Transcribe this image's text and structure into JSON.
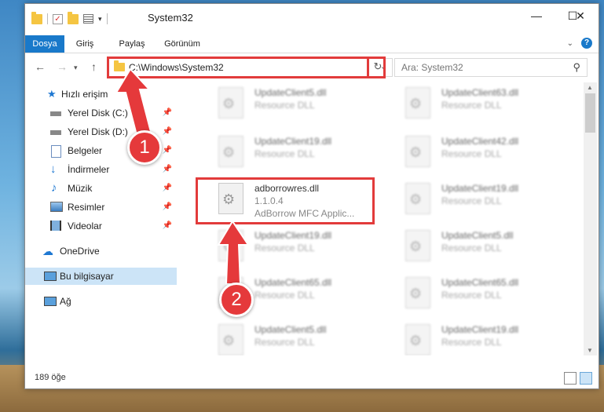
{
  "window": {
    "title": "System32"
  },
  "ribbon": {
    "tabs": [
      {
        "label": "Dosya",
        "active": true
      },
      {
        "label": "Giriş"
      },
      {
        "label": "Paylaş"
      },
      {
        "label": "Görünüm"
      }
    ],
    "help": "?"
  },
  "address": {
    "path": "C:\\Windows\\System32",
    "search_placeholder": "Ara: System32"
  },
  "nav_pane": {
    "quick_access": "Hızlı erişim",
    "items": [
      {
        "label": "Yerel Disk (C:)",
        "icon": "drive-icon",
        "pinned": true
      },
      {
        "label": "Yerel Disk (D:)",
        "icon": "drive-icon",
        "pinned": true
      },
      {
        "label": "Belgeler",
        "icon": "documents-icon",
        "pinned": true
      },
      {
        "label": "İndirmeler",
        "icon": "download-icon",
        "pinned": true
      },
      {
        "label": "Müzik",
        "icon": "music-icon",
        "pinned": true
      },
      {
        "label": "Resimler",
        "icon": "pictures-icon",
        "pinned": true
      },
      {
        "label": "Videolar",
        "icon": "videos-icon",
        "pinned": true
      }
    ],
    "onedrive": "OneDrive",
    "this_pc": "Bu bilgisayar",
    "network": "Ağ"
  },
  "files": {
    "left": [
      {
        "name": "UpdateClient5.dll",
        "desc": "Resource DLL"
      },
      {
        "name": "UpdateClient19.dll",
        "desc": "Resource DLL"
      },
      {
        "name": "adborrowres.dll",
        "version": "1.1.0.4",
        "desc": "AdBorrow MFC Applic...",
        "highlighted": true
      },
      {
        "name": "UpdateClient19.dll",
        "desc": "Resource DLL"
      },
      {
        "name": "UpdateClient65.dll",
        "desc": "Resource DLL"
      },
      {
        "name": "UpdateClient5.dll",
        "desc": "Resource DLL"
      }
    ],
    "right": [
      {
        "name": "UpdateClient63.dll",
        "desc": "Resource DLL"
      },
      {
        "name": "UpdateClient42.dll",
        "desc": "Resource DLL"
      },
      {
        "name": "UpdateClient19.dll",
        "desc": "Resource DLL"
      },
      {
        "name": "UpdateClient5.dll",
        "desc": "Resource DLL"
      },
      {
        "name": "UpdateClient65.dll",
        "desc": "Resource DLL"
      },
      {
        "name": "UpdateClient19.dll",
        "desc": "Resource DLL"
      }
    ]
  },
  "status": {
    "item_count": "189 öğe"
  },
  "annotations": {
    "step1": "1",
    "step2": "2",
    "highlight_color": "#e23b3b"
  }
}
